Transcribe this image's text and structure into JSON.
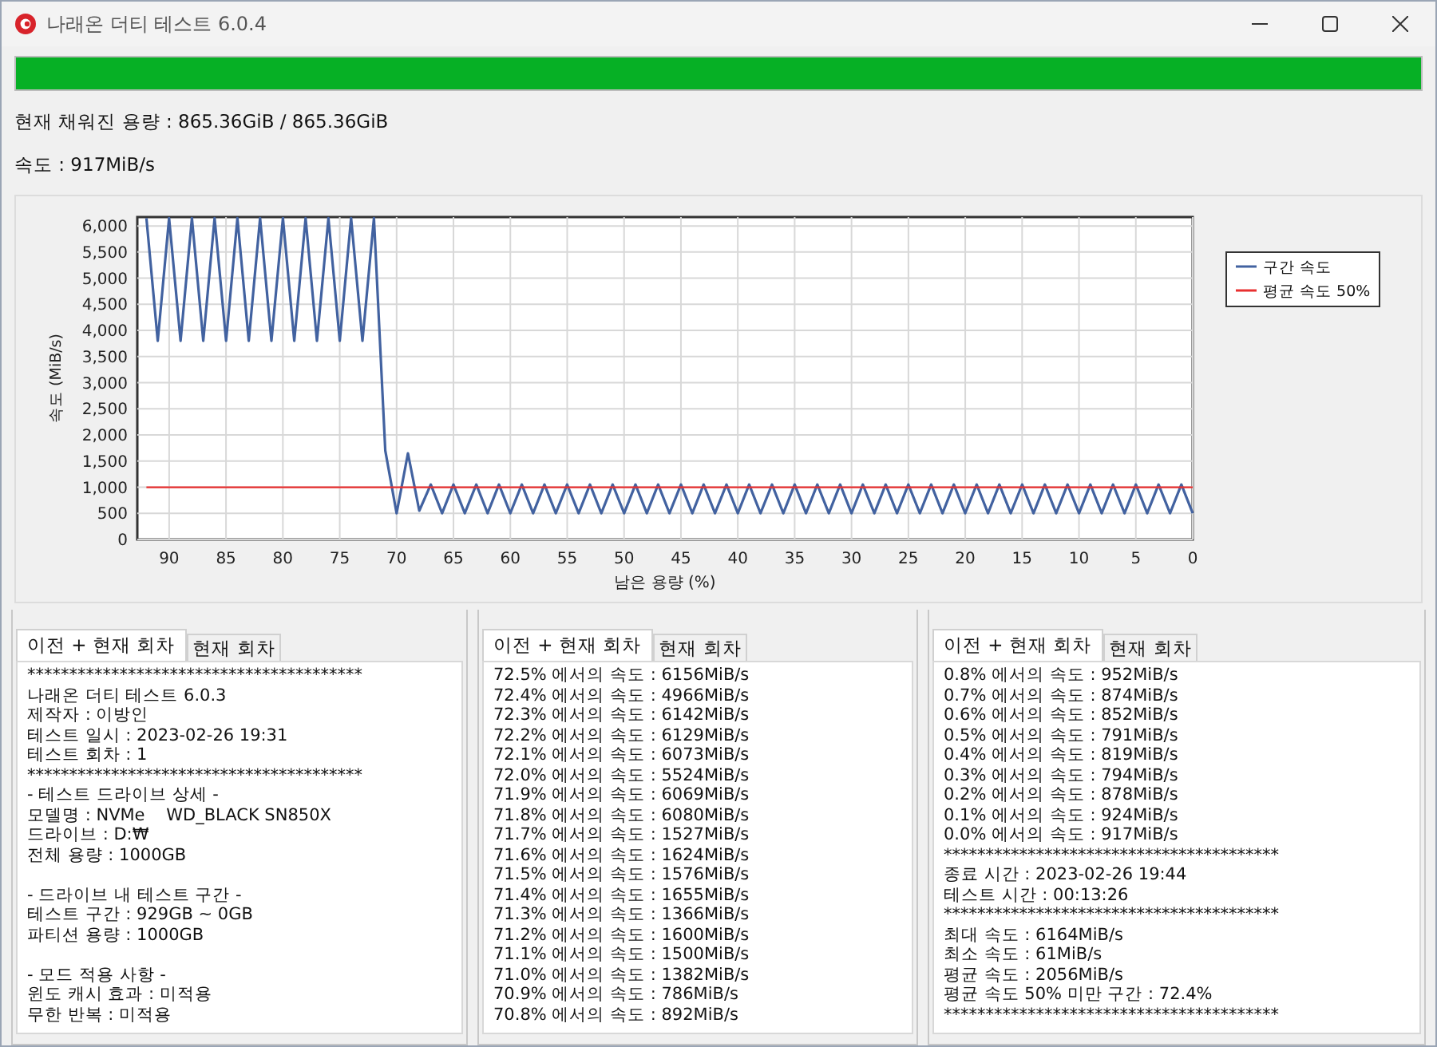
{
  "window": {
    "title": "나래온 더티 테스트 6.0.4"
  },
  "progress": {
    "level": 1
  },
  "status_lines": [
    "현재 채워진 용량 : 865.36GiB / 865.36GiB",
    "속도 : 917MiB/s"
  ],
  "chart": {
    "chart_data": {
      "type": "line",
      "xlabel": "남은 용량 (%)",
      "ylabel": "속도 (MiB/s)",
      "xlim": [
        92.8,
        0
      ],
      "ylim": [
        0,
        6170
      ],
      "xticks": [
        90,
        85,
        80,
        75,
        70,
        65,
        60,
        55,
        50,
        45,
        40,
        35,
        30,
        25,
        20,
        15,
        10,
        5,
        0
      ],
      "yticks": [
        {
          "value": 0,
          "label": "0"
        },
        {
          "value": 500,
          "label": "500"
        },
        {
          "value": 1000,
          "label": "1,000"
        },
        {
          "value": 1500,
          "label": "1,500"
        },
        {
          "value": 2000,
          "label": "2,000"
        },
        {
          "value": 2500,
          "label": "2,500"
        },
        {
          "value": 3000,
          "label": "3,000"
        },
        {
          "value": 3500,
          "label": "3,500"
        },
        {
          "value": 4000,
          "label": "4,000"
        },
        {
          "value": 4500,
          "label": "4,500"
        },
        {
          "value": 5000,
          "label": "5,000"
        },
        {
          "value": 5500,
          "label": "5,500"
        },
        {
          "value": 6000,
          "label": "6,000"
        }
      ],
      "x": [
        92,
        91,
        90,
        89,
        88,
        87,
        86,
        85,
        84,
        83,
        82,
        81,
        80,
        79,
        78,
        77,
        76,
        75,
        74,
        73,
        72,
        71,
        70,
        69,
        68,
        67,
        66,
        65,
        64,
        63,
        62,
        61,
        60,
        59,
        58,
        57,
        56,
        55,
        54,
        53,
        52,
        51,
        50,
        49,
        48,
        47,
        46,
        45,
        44,
        43,
        42,
        41,
        40,
        39,
        38,
        37,
        36,
        35,
        34,
        33,
        32,
        31,
        30,
        29,
        28,
        27,
        26,
        25,
        24,
        23,
        22,
        21,
        20,
        19,
        18,
        17,
        16,
        15,
        14,
        13,
        12,
        11,
        10,
        9,
        8,
        7,
        6,
        5,
        4,
        3,
        2,
        1,
        0
      ],
      "series": [
        {
          "name": "구간 속도",
          "color": "#4262a0",
          "values": [
            6150,
            3800,
            6150,
            3800,
            6150,
            3800,
            6150,
            3800,
            6150,
            3800,
            6150,
            3800,
            6150,
            3800,
            6150,
            3800,
            6150,
            3800,
            6150,
            3800,
            6150,
            1700,
            500,
            1650,
            550,
            1050,
            500,
            1050,
            500,
            1050,
            500,
            1050,
            500,
            1050,
            500,
            1050,
            500,
            1050,
            500,
            1050,
            500,
            1050,
            500,
            1050,
            500,
            1050,
            500,
            1050,
            500,
            1050,
            500,
            1050,
            500,
            1050,
            500,
            1050,
            500,
            1050,
            500,
            1050,
            500,
            1050,
            500,
            1050,
            500,
            1050,
            500,
            1050,
            500,
            1050,
            500,
            1050,
            500,
            1050,
            500,
            1050,
            500,
            1050,
            500,
            1050,
            500,
            1050,
            500,
            1050,
            500,
            1050,
            500,
            1050,
            500,
            1050,
            500,
            1050,
            500
          ]
        },
        {
          "name": "평균 속도 50%",
          "color": "#e83030",
          "values": [
            1000,
            1000,
            1000,
            1000,
            1000,
            1000,
            1000,
            1000,
            1000,
            1000,
            1000,
            1000,
            1000,
            1000,
            1000,
            1000,
            1000,
            1000,
            1000,
            1000,
            1000,
            1000,
            1000,
            1000,
            1000,
            1000,
            1000,
            1000,
            1000,
            1000,
            1000,
            1000,
            1000,
            1000,
            1000,
            1000,
            1000,
            1000,
            1000,
            1000,
            1000,
            1000,
            1000,
            1000,
            1000,
            1000,
            1000,
            1000,
            1000,
            1000,
            1000,
            1000,
            1000,
            1000,
            1000,
            1000,
            1000,
            1000,
            1000,
            1000,
            1000,
            1000,
            1000,
            1000,
            1000,
            1000,
            1000,
            1000,
            1000,
            1000,
            1000,
            1000,
            1000,
            1000,
            1000,
            1000,
            1000,
            1000,
            1000,
            1000,
            1000,
            1000,
            1000,
            1000,
            1000,
            1000,
            1000,
            1000,
            1000,
            1000,
            1000,
            1000,
            1000
          ]
        }
      ],
      "grid": true,
      "legend": true
    }
  },
  "log_panels": [
    {
      "tabs": [
        {
          "label": "이전 + 현재 회차",
          "selected": true
        },
        {
          "label": "현재 회차",
          "selected": false
        }
      ],
      "blocks": [
        [
          "****************************************",
          "나래온 더티 테스트 6.0.3",
          "제작자 : 이방인",
          "테스트 일시 : 2023-02-26 19:31",
          "테스트 회차 : 1",
          "****************************************",
          "- 테스트 드라이브 상세 -",
          "모델명 : NVMe    WD_BLACK SN850X",
          "드라이브 : D:₩",
          "전체 용량 : 1000GB"
        ],
        [
          "- 드라이브 내 테스트 구간 -",
          "테스트 구간 : 929GB ~ 0GB",
          "파티션 용량 : 1000GB"
        ],
        [
          "- 모드 적용 사항 -",
          "윈도 캐시 효과 : 미적용",
          "무한 반복 : 미적용"
        ]
      ]
    },
    {
      "tabs": [
        {
          "label": "이전 + 현재 회차",
          "selected": true
        },
        {
          "label": "현재 회차",
          "selected": false
        }
      ],
      "blocks": [
        [
          "72.5% 에서의 속도 : 6156MiB/s",
          "72.4% 에서의 속도 : 4966MiB/s",
          "72.3% 에서의 속도 : 6142MiB/s",
          "72.2% 에서의 속도 : 6129MiB/s",
          "72.1% 에서의 속도 : 6073MiB/s",
          "72.0% 에서의 속도 : 5524MiB/s",
          "71.9% 에서의 속도 : 6069MiB/s",
          "71.8% 에서의 속도 : 6080MiB/s",
          "71.7% 에서의 속도 : 1527MiB/s",
          "71.6% 에서의 속도 : 1624MiB/s",
          "71.5% 에서의 속도 : 1576MiB/s",
          "71.4% 에서의 속도 : 1655MiB/s",
          "71.3% 에서의 속도 : 1366MiB/s",
          "71.2% 에서의 속도 : 1600MiB/s",
          "71.1% 에서의 속도 : 1500MiB/s",
          "71.0% 에서의 속도 : 1382MiB/s",
          "70.9% 에서의 속도 : 786MiB/s",
          "70.8% 에서의 속도 : 892MiB/s"
        ]
      ]
    },
    {
      "tabs": [
        {
          "label": "이전 + 현재 회차",
          "selected": true
        },
        {
          "label": "현재 회차",
          "selected": false
        }
      ],
      "blocks": [
        [
          "0.8% 에서의 속도 : 952MiB/s",
          "0.7% 에서의 속도 : 874MiB/s",
          "0.6% 에서의 속도 : 852MiB/s",
          "0.5% 에서의 속도 : 791MiB/s",
          "0.4% 에서의 속도 : 819MiB/s",
          "0.3% 에서의 속도 : 794MiB/s",
          "0.2% 에서의 속도 : 878MiB/s",
          "0.1% 에서의 속도 : 924MiB/s",
          "0.0% 에서의 속도 : 917MiB/s",
          "****************************************",
          "종료 시간 : 2023-02-26 19:44",
          "테스트 시간 : 00:13:26",
          "****************************************",
          "최대 속도 : 6164MiB/s",
          "최소 속도 : 61MiB/s",
          "평균 속도 : 2056MiB/s",
          "평균 속도 50% 미만 구간 : 72.4%",
          "****************************************"
        ]
      ]
    }
  ]
}
